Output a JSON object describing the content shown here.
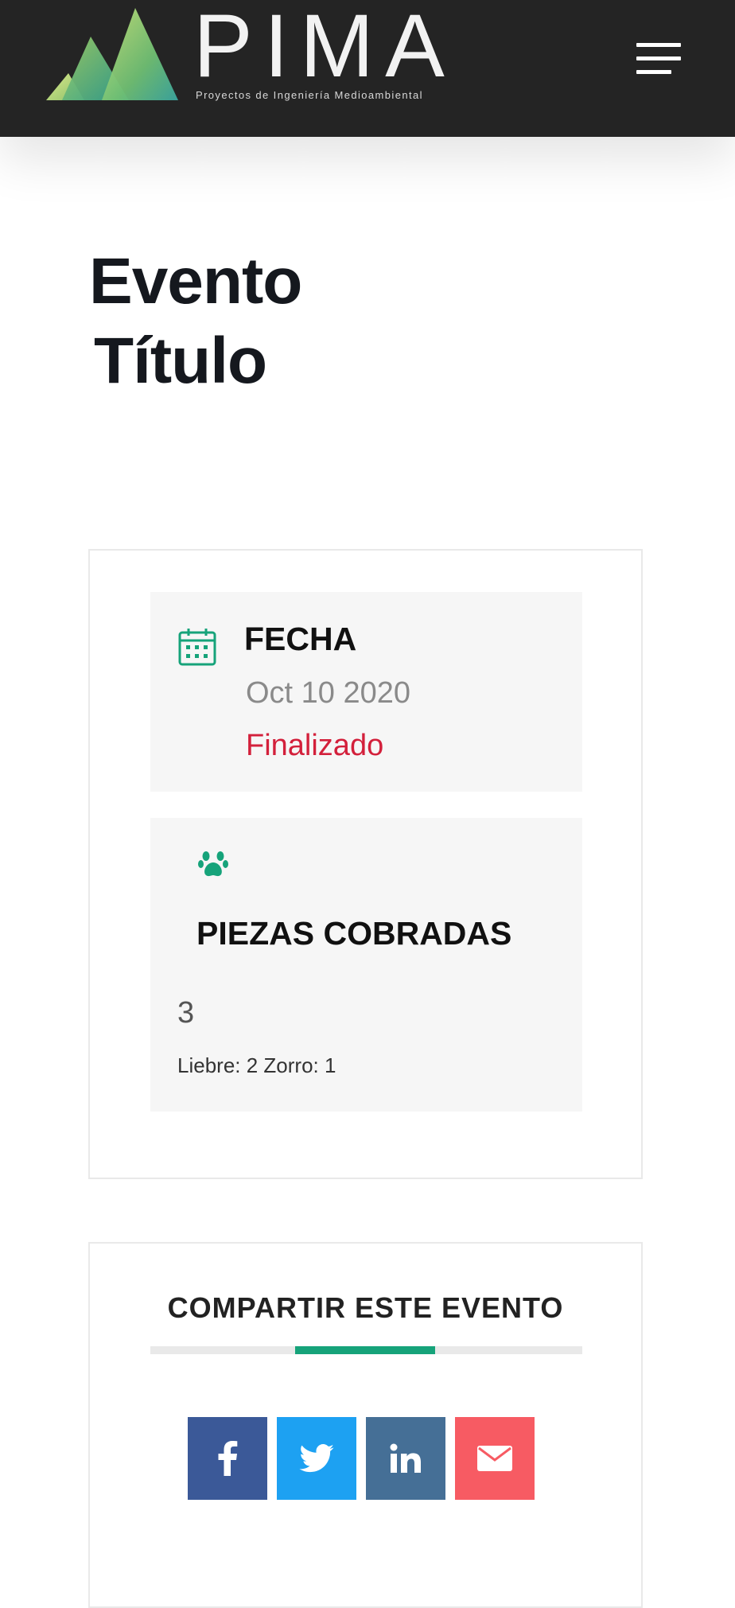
{
  "header": {
    "logo_text": "PIMA",
    "logo_subtitle": "Proyectos de Ingeniería Medioambiental",
    "menu_icon": "hamburger-menu-icon"
  },
  "page": {
    "title_line1": "Evento",
    "title_line2": "Título"
  },
  "date_box": {
    "icon": "calendar-icon",
    "label": "FECHA",
    "value": "Oct 10 2020",
    "status": "Finalizado",
    "status_color": "#d3203b"
  },
  "pieces_box": {
    "icon": "paw-icon",
    "label": "PIEZAS COBRADAS",
    "count": "3",
    "breakdown": "Liebre: 2 Zorro: 1"
  },
  "share": {
    "title": "COMPARTIR ESTE EVENTO",
    "accent_color": "#16a37a",
    "buttons": [
      {
        "network": "facebook",
        "icon": "facebook-icon",
        "color": "#3b5998"
      },
      {
        "network": "twitter",
        "icon": "twitter-icon",
        "color": "#1da1f2"
      },
      {
        "network": "linkedin",
        "icon": "linkedin-icon",
        "color": "#456f96"
      },
      {
        "network": "email",
        "icon": "envelope-icon",
        "color": "#f75b63"
      }
    ]
  }
}
